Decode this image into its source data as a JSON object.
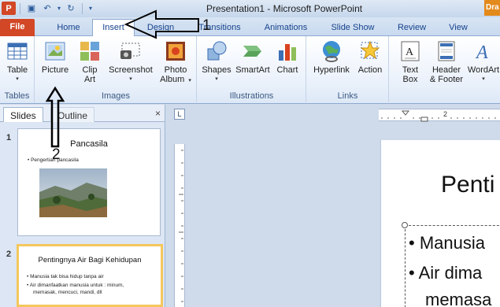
{
  "app": {
    "title": "Presentation1  -  Microsoft PowerPoint",
    "dra_tab": "Dra",
    "qat": {
      "undo_glyph": "↶",
      "redo_glyph": "↻",
      "save_glyph": "▣",
      "more_glyph": "▾",
      "logo": "P"
    }
  },
  "tabs": [
    {
      "label": "File"
    },
    {
      "label": "Home"
    },
    {
      "label": "Insert"
    },
    {
      "label": "Design"
    },
    {
      "label": "Transitions"
    },
    {
      "label": "Animations"
    },
    {
      "label": "Slide Show"
    },
    {
      "label": "Review"
    },
    {
      "label": "View"
    }
  ],
  "ribbon": {
    "groups": {
      "tables": "Tables",
      "images": "Images",
      "illustrations": "Illustrations",
      "links": "Links"
    },
    "buttons": {
      "table": "Table",
      "picture": "Picture",
      "clip_art_1": "Clip",
      "clip_art_2": "Art",
      "screenshot": "Screenshot",
      "photo_album_1": "Photo",
      "photo_album_2": "Album",
      "shapes": "Shapes",
      "smartart": "SmartArt",
      "chart": "Chart",
      "hyperlink": "Hyperlink",
      "action": "Action",
      "text_box_1": "Text",
      "text_box_2": "Box",
      "header_footer_1": "Header",
      "header_footer_2": "& Footer",
      "wordart": "WordArt"
    },
    "dropdown_glyph": "▾"
  },
  "pane": {
    "tab_slides": "Slides",
    "tab_outline": "Outline",
    "close_glyph": "×"
  },
  "slides": [
    {
      "number": "1",
      "title": "Pancasila",
      "bullets": [
        "Pengertian pancasila"
      ]
    },
    {
      "number": "2",
      "title": "Pentingnya Air Bagi Kehidupan",
      "bullets": [
        "Manusia tak bisa hidup tanpa air",
        "Air dimanfaatkan manusia untuk : minum,",
        "memasak, mencuci, mandi, dll"
      ]
    }
  ],
  "editor": {
    "title": "Penti",
    "bullet1": "Manusia",
    "bullet2": "Air dima",
    "bullet3": "memasa",
    "ruler_corner": "L",
    "ruler_mark": "2"
  },
  "annotations": {
    "label1": "1",
    "label2": "2"
  }
}
